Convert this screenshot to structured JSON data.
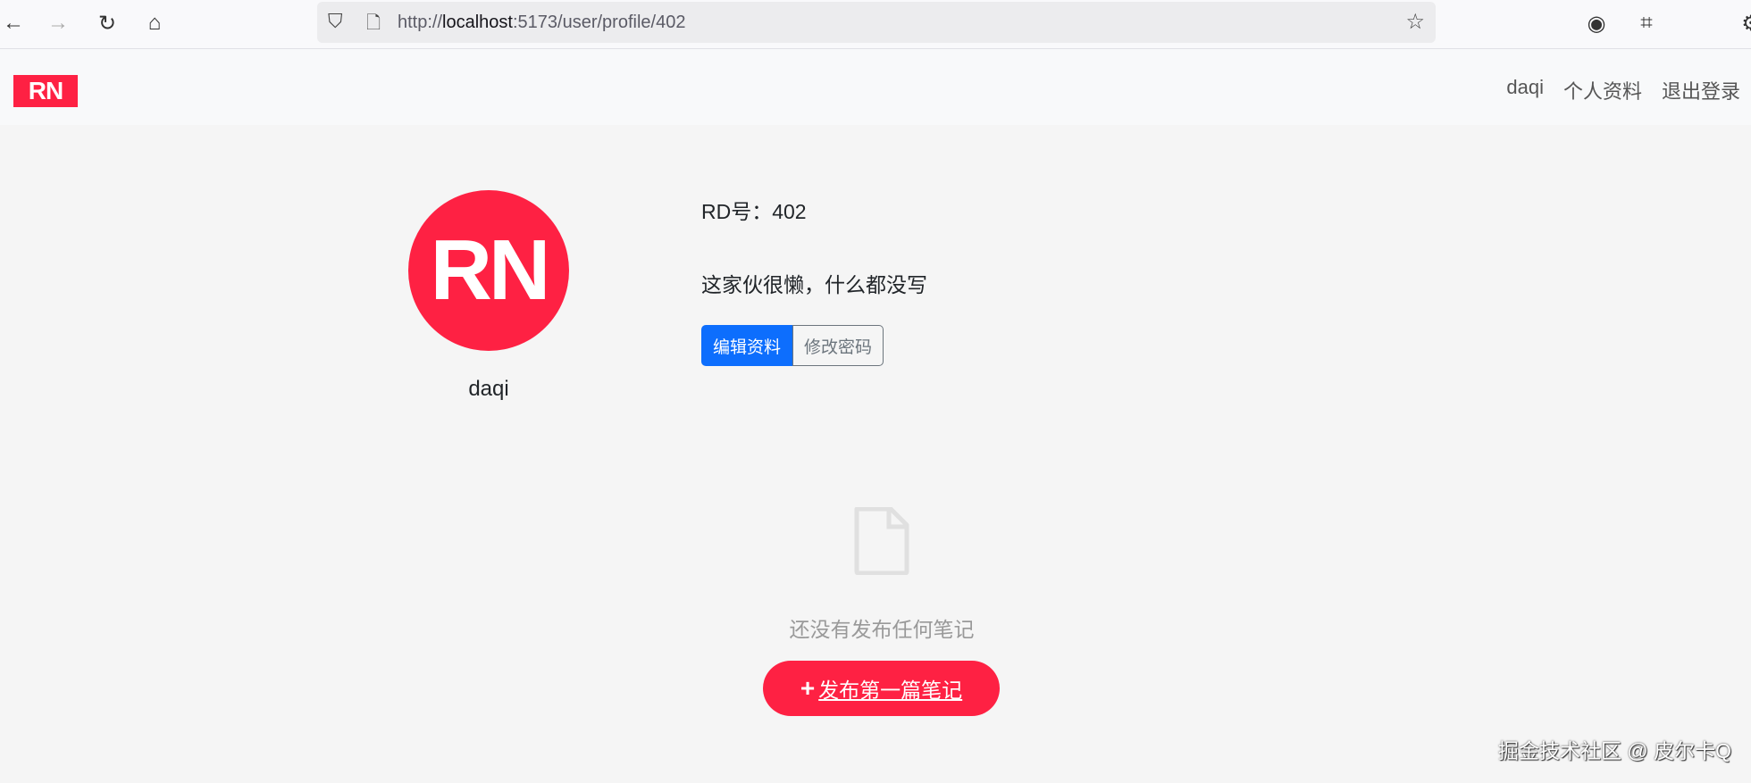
{
  "browser": {
    "url_prefix": "http://",
    "url_host": "localhost",
    "url_rest": ":5173/user/profile/402"
  },
  "navbar": {
    "logo": "RN",
    "links": [
      "daqi",
      "个人资料",
      "退出登录"
    ]
  },
  "profile": {
    "avatar_text": "RN",
    "username": "daqi",
    "rd_number": "RD号：402",
    "bio": "这家伙很懒，什么都没写",
    "edit_button": "编辑资料",
    "password_button": "修改密码"
  },
  "notes": {
    "empty_text": "还没有发布任何笔记",
    "publish_button": "发布第一篇笔记",
    "publish_icon": "+"
  },
  "watermark": "掘金技术社区 @ 皮尔卡Q",
  "colors": {
    "brand": "#fe2143",
    "primary": "#0d6efd"
  }
}
